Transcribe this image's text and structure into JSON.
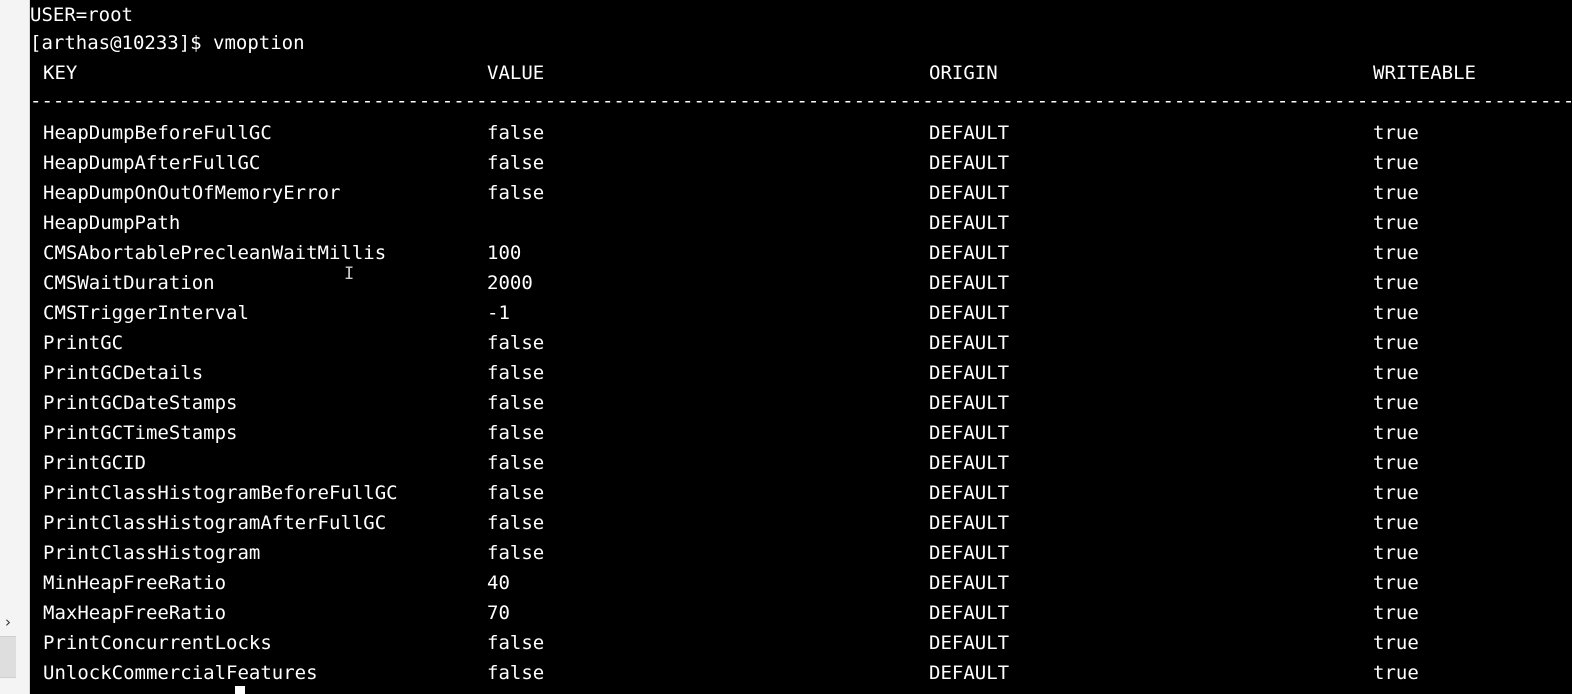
{
  "side_panel": {
    "chevron_icon": "chevron-right-icon",
    "chevron_glyph": "›"
  },
  "terminal": {
    "lines": [
      "USER=root",
      "[arthas@10233]$ vmoption"
    ],
    "separator": "--------------------------------------------------------------------------------------------------------------------------------------------------------------------------------------------------------------------------------------------------------------------------------",
    "cursor_icon": "terminal-cursor-icon",
    "mouse_pointer_icon": "i-beam-cursor-icon"
  },
  "table": {
    "headers": {
      "key": "KEY",
      "value": "VALUE",
      "origin": "ORIGIN",
      "writeable": "WRITEABLE"
    },
    "rows": [
      {
        "key": "HeapDumpBeforeFullGC",
        "value": "false",
        "origin": "DEFAULT",
        "writeable": "true"
      },
      {
        "key": "HeapDumpAfterFullGC",
        "value": "false",
        "origin": "DEFAULT",
        "writeable": "true"
      },
      {
        "key": "HeapDumpOnOutOfMemoryError",
        "value": "false",
        "origin": "DEFAULT",
        "writeable": "true"
      },
      {
        "key": "HeapDumpPath",
        "value": "",
        "origin": "DEFAULT",
        "writeable": "true"
      },
      {
        "key": "CMSAbortablePrecleanWaitMillis",
        "value": "100",
        "origin": "DEFAULT",
        "writeable": "true"
      },
      {
        "key": "CMSWaitDuration",
        "value": "2000",
        "origin": "DEFAULT",
        "writeable": "true"
      },
      {
        "key": "CMSTriggerInterval",
        "value": "-1",
        "origin": "DEFAULT",
        "writeable": "true"
      },
      {
        "key": "PrintGC",
        "value": "false",
        "origin": "DEFAULT",
        "writeable": "true"
      },
      {
        "key": "PrintGCDetails",
        "value": "false",
        "origin": "DEFAULT",
        "writeable": "true"
      },
      {
        "key": "PrintGCDateStamps",
        "value": "false",
        "origin": "DEFAULT",
        "writeable": "true"
      },
      {
        "key": "PrintGCTimeStamps",
        "value": "false",
        "origin": "DEFAULT",
        "writeable": "true"
      },
      {
        "key": "PrintGCID",
        "value": "false",
        "origin": "DEFAULT",
        "writeable": "true"
      },
      {
        "key": "PrintClassHistogramBeforeFullGC",
        "value": "false",
        "origin": "DEFAULT",
        "writeable": "true"
      },
      {
        "key": "PrintClassHistogramAfterFullGC",
        "value": "false",
        "origin": "DEFAULT",
        "writeable": "true"
      },
      {
        "key": "PrintClassHistogram",
        "value": "false",
        "origin": "DEFAULT",
        "writeable": "true"
      },
      {
        "key": "MinHeapFreeRatio",
        "value": "40",
        "origin": "DEFAULT",
        "writeable": "true"
      },
      {
        "key": "MaxHeapFreeRatio",
        "value": "70",
        "origin": "DEFAULT",
        "writeable": "true"
      },
      {
        "key": "PrintConcurrentLocks",
        "value": "false",
        "origin": "DEFAULT",
        "writeable": "true"
      },
      {
        "key": "UnlockCommercialFeatures",
        "value": "false",
        "origin": "DEFAULT",
        "writeable": "true"
      }
    ]
  },
  "colors": {
    "terminal_background": "#000000",
    "terminal_text": "#ffffff",
    "side_panel": "#f4f4f4"
  }
}
